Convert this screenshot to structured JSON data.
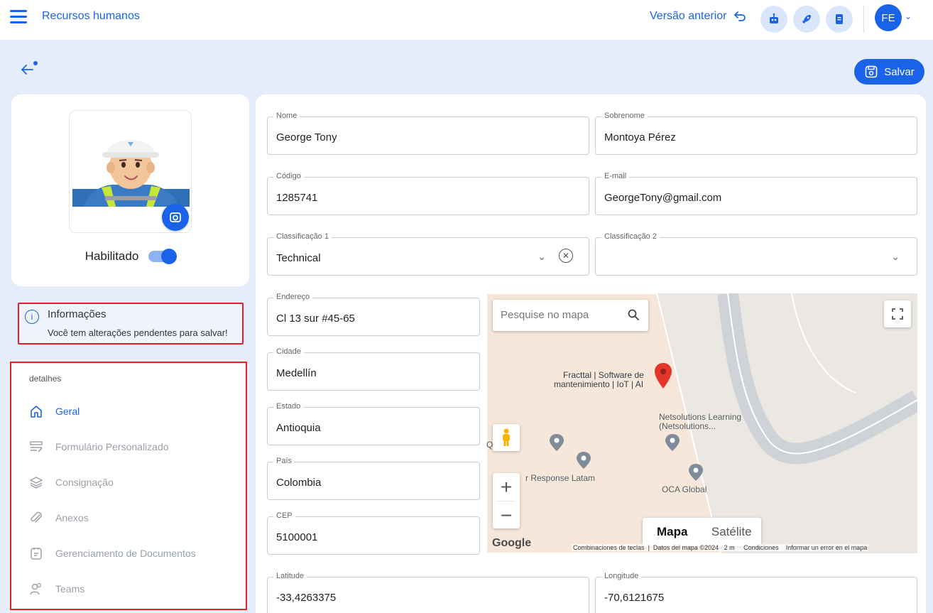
{
  "header": {
    "app_title": "Recursos humanos",
    "prev_version": "Versão anterior",
    "avatar_initials": "FE"
  },
  "toolbar": {
    "save_label": "Salvar"
  },
  "profile": {
    "enabled_label": "Habilitado",
    "enabled": true
  },
  "info": {
    "title": "Informações",
    "message": "Você tem alterações pendentes para salvar!"
  },
  "details": {
    "heading": "detalhes",
    "items": [
      {
        "label": "Geral",
        "icon": "home-icon",
        "active": true
      },
      {
        "label": "Formulário Personalizado",
        "icon": "form-icon",
        "active": false
      },
      {
        "label": "Consignação",
        "icon": "layers-icon",
        "active": false
      },
      {
        "label": "Anexos",
        "icon": "paperclip-icon",
        "active": false
      },
      {
        "label": "Gerenciamento de Documentos",
        "icon": "document-icon",
        "active": false
      },
      {
        "label": "Teams",
        "icon": "users-icon",
        "active": false
      }
    ]
  },
  "form": {
    "nome": {
      "label": "Nome",
      "value": "George Tony"
    },
    "sobrenome": {
      "label": "Sobrenome",
      "value": "Montoya Pérez"
    },
    "codigo": {
      "label": "Código",
      "value": "1285741"
    },
    "email": {
      "label": "E-mail",
      "value": "GeorgeTony@gmail.com"
    },
    "class1": {
      "label": "Classificação 1",
      "value": "Technical"
    },
    "class2": {
      "label": "Classificação 2",
      "value": ""
    },
    "endereco": {
      "label": "Endereço",
      "value": "Cl 13 sur #45-65"
    },
    "cidade": {
      "label": "Cidade",
      "value": "Medellín"
    },
    "estado": {
      "label": "Estado",
      "value": "Antioquia"
    },
    "pais": {
      "label": "País",
      "value": "Colombia"
    },
    "cep": {
      "label": "CEP",
      "value": "5100001"
    },
    "latitude": {
      "label": "Latitude",
      "value": "-33,4263375"
    },
    "longitude": {
      "label": "Longitude",
      "value": "-70,6121675"
    }
  },
  "map": {
    "search_placeholder": "Pesquise no mapa",
    "type_map": "Mapa",
    "type_satellite": "Satélite",
    "google": "Google",
    "attribution": {
      "shortcuts": "Combinaciones de teclas",
      "data": "Datos del mapa ©2024",
      "scale": "2 m",
      "terms": "Condiciones",
      "report": "Informar un error en el mapa"
    },
    "poi": {
      "fracttal_1": "Fracttal | Software de",
      "fracttal_2": "mantenimiento | IoT | AI",
      "netsolutions_1": "Netsolutions Learning",
      "netsolutions_2": "(Netsolutions...",
      "quem": "QUEM",
      "response": "r Response Latam",
      "oca": "OCA Global"
    }
  },
  "colors": {
    "accent": "#1a63e8",
    "highlight": "#e0202a",
    "page_bg": "#e5edfa"
  }
}
